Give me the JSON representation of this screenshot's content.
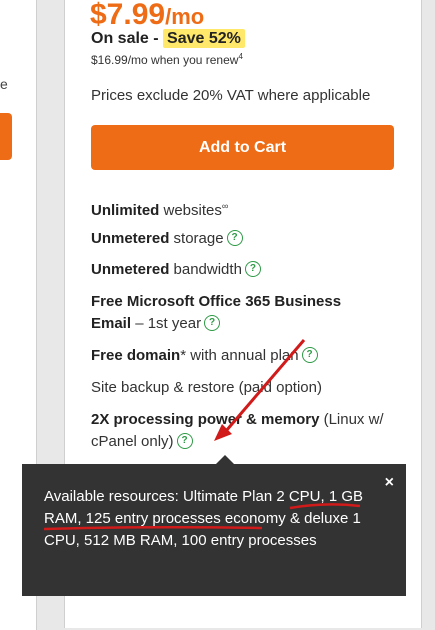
{
  "left": {
    "partial_text": "e"
  },
  "plan": {
    "price_amount": "$7.99",
    "price_period": "/mo",
    "sale_label": "On sale - ",
    "save_badge": "Save 52%",
    "renew_text": "$16.99/mo when you renew",
    "renew_footnote": "4",
    "vat_note": "Prices exclude 20% VAT where applicable",
    "add_to_cart": "Add to Cart"
  },
  "features": {
    "f1_bold": "Unlimited",
    "f1_rest": " websites",
    "f1_sup": "∞",
    "f2_bold": "Unmetered",
    "f2_rest": " storage",
    "f3_bold": "Unmetered",
    "f3_rest": " bandwidth",
    "f4_bold": "Free Microsoft Office 365 Business Email",
    "f4_rest": " – 1st year",
    "f5_bold": "Free domain",
    "f5_rest": "* with annual plan",
    "f6_rest": "Site backup & restore (paid option)",
    "f7_bold": "2X processing power & memory",
    "f7_rest": " (Linux w/ cPanel only)"
  },
  "tooltip": {
    "text": "Available resources: Ultimate Plan 2 CPU, 1 GB RAM, 125 entry processes economy & deluxe 1 CPU, 512 MB RAM, 100 entry processes",
    "close": "×"
  },
  "colors": {
    "accent": "#ee6c16",
    "help": "#2e9b46",
    "annotation": "#d11a1a"
  }
}
